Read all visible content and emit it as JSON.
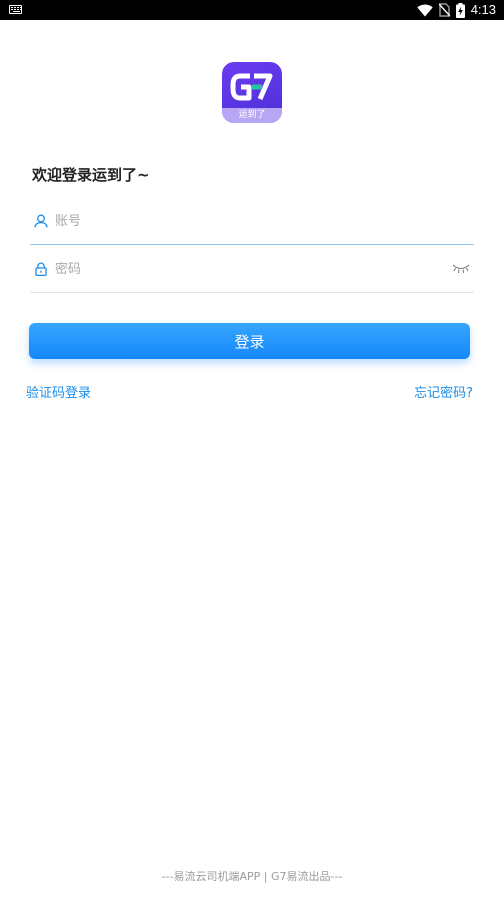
{
  "status_bar": {
    "time": "4:13",
    "icons": [
      "keyboard-icon",
      "wifi-icon",
      "no-sim-icon",
      "battery-charging-icon"
    ]
  },
  "logo": {
    "mark_text": "G7",
    "tagline": "运到了",
    "colors": {
      "primary": "#5a35e6",
      "band": "#b7a6f3",
      "accent": "#23c4a6"
    }
  },
  "welcome_text": "欢迎登录运到了~",
  "form": {
    "account": {
      "placeholder": "账号",
      "value": "",
      "icon": "user-icon"
    },
    "password": {
      "placeholder": "密码",
      "value": "",
      "icon": "lock-icon",
      "toggle_icon": "eye-closed-icon"
    }
  },
  "login_button": {
    "label": "登录",
    "color": "#1c8cfb"
  },
  "links": {
    "sms_login": "验证码登录",
    "forgot_password": "忘记密码?"
  },
  "footer": "---易流云司机端APP | G7易流出品---"
}
